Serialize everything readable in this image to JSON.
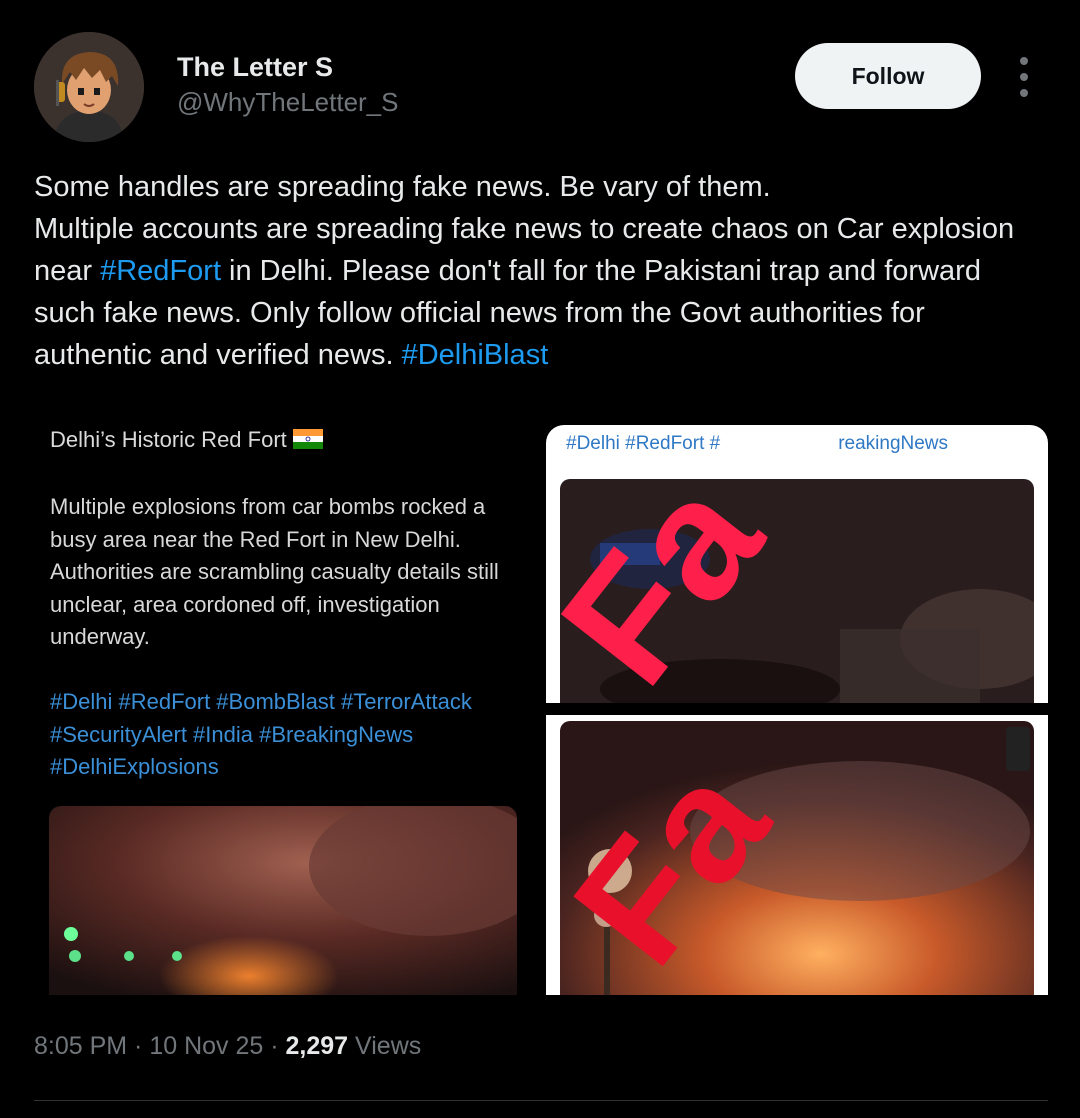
{
  "author": {
    "name": "The Letter S",
    "handle": "@WhyTheLetter_S"
  },
  "follow_label": "Follow",
  "more_icon": "more-vertical-icon",
  "tweet": {
    "line1": "Some handles are spreading fake news. Be vary of them.",
    "line2_before": "Multiple accounts are spreading fake news to create chaos on Car explosion near ",
    "hashtag1": "#RedFort",
    "line2_after": " in Delhi. Please don't fall for the Pakistani trap and forward such fake news. Only follow official news from the Govt authorities for authentic and verified news. ",
    "hashtag2": "#DelhiBlast"
  },
  "media": {
    "left": {
      "title": "Delhi’s Historic Red Fort",
      "body": "Multiple explosions from car bombs rocked a busy area near the Red Fort in New Delhi. Authorities are scrambling casualty details still unclear, area cordoned off, investigation underway.",
      "tags": "#Delhi #RedFort #BombBlast #TerrorAttack #SecurityAlert #India #BreakingNews #DelhiExplosions"
    },
    "right": {
      "header_left": "#Delhi #RedFort #",
      "header_right": "reakingNews",
      "stamp_top": "Fa",
      "stamp_bottom": "Fa"
    }
  },
  "meta": {
    "time": "8:05 PM",
    "sep1": " · ",
    "date": "10 Nov 25",
    "sep2": " · ",
    "views_count": "2,297",
    "views_label": " Views"
  },
  "colors": {
    "accent": "#1d9bf0",
    "muted": "#71767b",
    "stamp": "#ff1f4b"
  }
}
